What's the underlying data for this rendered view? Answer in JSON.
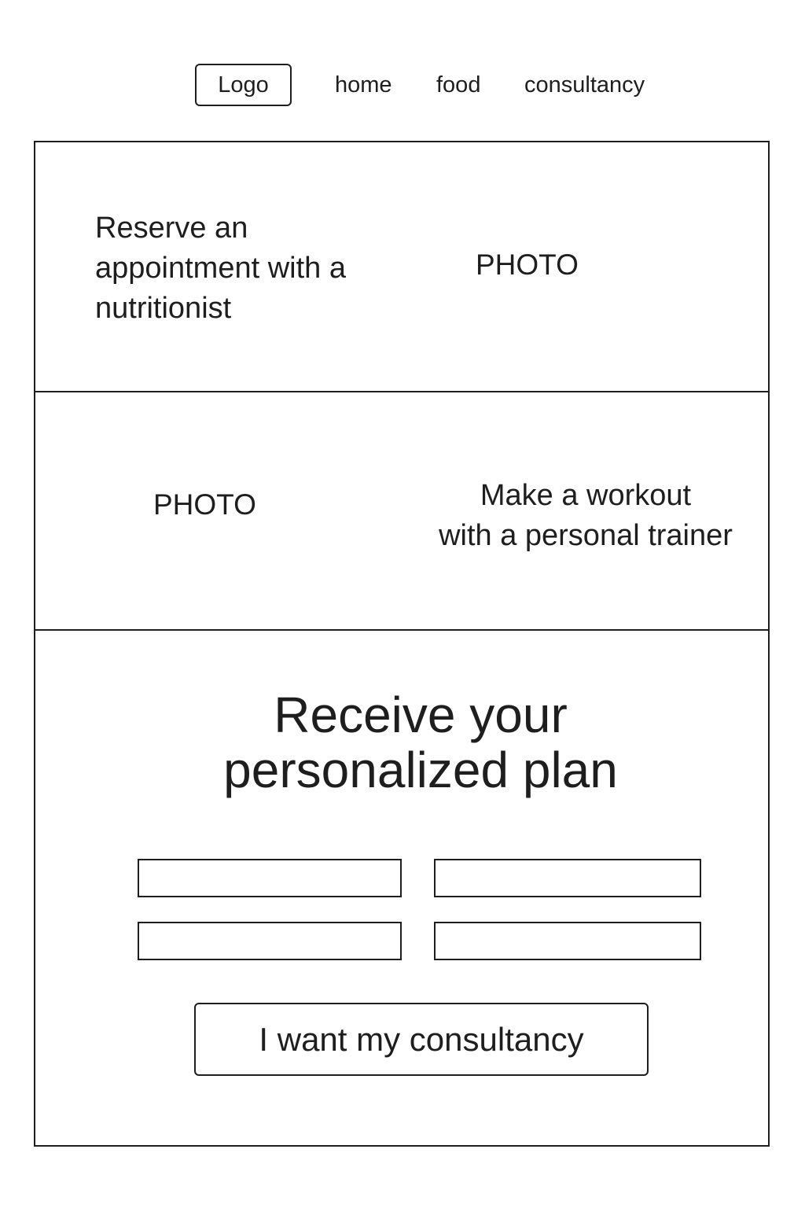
{
  "header": {
    "logo_label": "Logo",
    "nav": [
      {
        "label": "home"
      },
      {
        "label": "food"
      },
      {
        "label": "consultancy"
      }
    ]
  },
  "sections": {
    "nutritionist": {
      "text": "Reserve an appointment with a nutritionist",
      "photo_label": "PHOTO"
    },
    "trainer": {
      "photo_label": "PHOTO",
      "text_line1": "Make a workout",
      "text_line2": "with a personal trainer"
    },
    "plan": {
      "heading_line1": "Receive your",
      "heading_line2": "personalized plan",
      "fields": [
        {
          "value": "",
          "placeholder": ""
        },
        {
          "value": "",
          "placeholder": ""
        },
        {
          "value": "",
          "placeholder": ""
        },
        {
          "value": "",
          "placeholder": ""
        }
      ],
      "button_label": "I want my consultancy"
    }
  }
}
